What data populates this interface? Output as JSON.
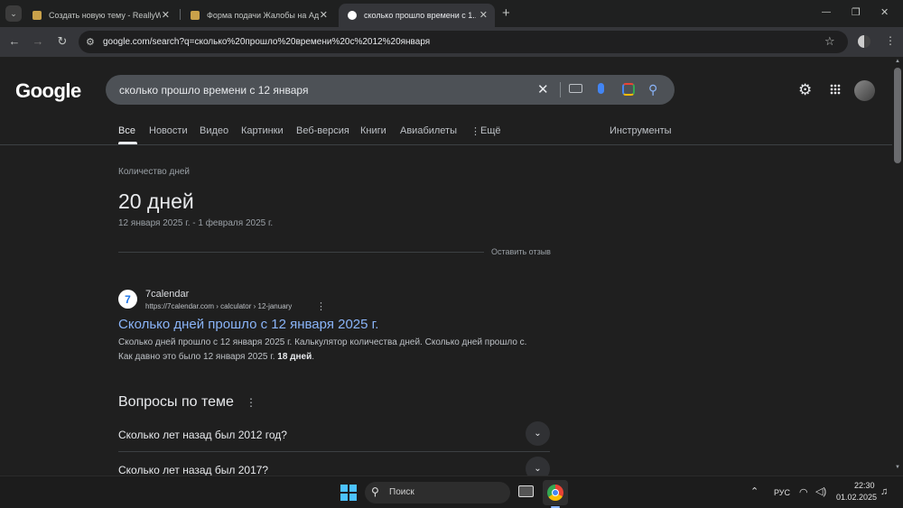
{
  "browser": {
    "tabs": [
      {
        "title": "Создать новую тему - ReallyW...",
        "active": false
      },
      {
        "title": "Форма подачи Жалобы на Ад...",
        "active": false
      },
      {
        "title": "сколько прошло времени с 1...",
        "active": true
      }
    ],
    "new_tab_symbol": "+",
    "url": "google.com/search?q=сколько%20прошло%20времени%20с%2012%20января",
    "window_controls": {
      "minimize": "—",
      "maximize": "❐",
      "close": "✕"
    }
  },
  "google": {
    "logo": "Google",
    "query": "сколько прошло времени с 12 января",
    "tabs": [
      "Все",
      "Новости",
      "Видео",
      "Картинки",
      "Веб-версия",
      "Книги",
      "Авиабилеты",
      "Ещё"
    ],
    "tools": "Инструменты"
  },
  "answer": {
    "label": "Количество дней",
    "value": "20 дней",
    "range": "12 января 2025 г. - 1 февраля 2025 г.",
    "feedback": "Оставить отзыв"
  },
  "result": {
    "site_name": "7calendar",
    "breadcrumb": "https://7calendar.com › calculator › 12-january",
    "title": "Сколько дней прошло с 12 января 2025 г.",
    "snippet_line1": "Сколько дней прошло с 12 января 2025 г. Калькулятор количества дней. Сколько дней прошло с.",
    "snippet_line2_prefix": "Как давно это было 12 января 2025 г. ",
    "snippet_bold": "18 дней",
    "snippet_suffix": "."
  },
  "related": {
    "heading": "Вопросы по теме",
    "questions": [
      "Сколько лет назад был 2012 год?",
      "Сколько лет назад был 2017?"
    ]
  },
  "taskbar": {
    "search_placeholder": "Поиск",
    "language": "РУС",
    "time": "22:30",
    "date": "01.02.2025"
  },
  "colors": {
    "link": "#8ab4f8",
    "accent_blue": "#4285f4",
    "page_bg": "#1f1f1f"
  }
}
